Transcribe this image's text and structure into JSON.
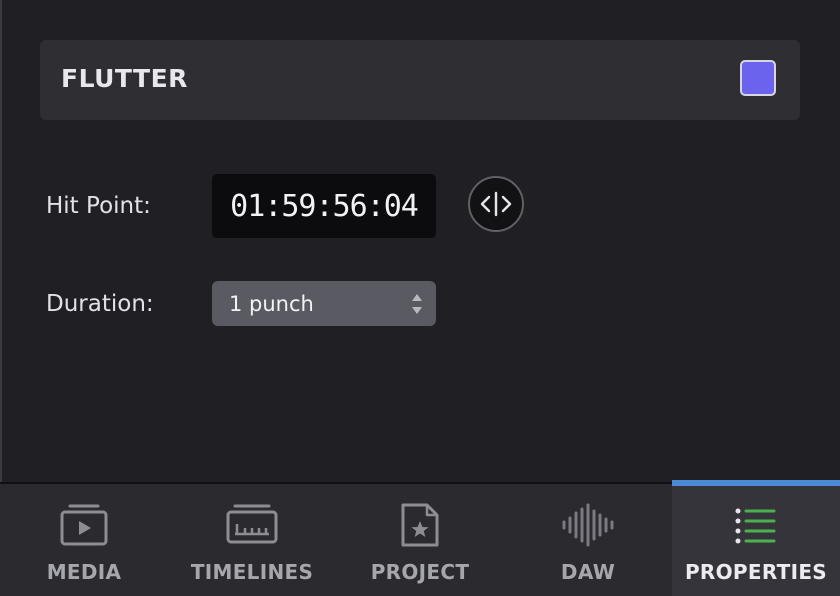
{
  "header": {
    "title": "FLUTTER",
    "swatch_color": "#6b63ee"
  },
  "hit_point": {
    "label": "Hit Point:",
    "timecode": "01:59:56:04"
  },
  "duration": {
    "label": "Duration:",
    "value": "1 punch"
  },
  "tabs": [
    {
      "label": "MEDIA",
      "icon": "media-icon",
      "active": false
    },
    {
      "label": "TIMELINES",
      "icon": "timelines-icon",
      "active": false
    },
    {
      "label": "PROJECT",
      "icon": "project-icon",
      "active": false
    },
    {
      "label": "DAW",
      "icon": "daw-icon",
      "active": false
    },
    {
      "label": "PROPERTIES",
      "icon": "properties-icon",
      "active": true
    }
  ],
  "colors": {
    "accent": "#4a8ad6",
    "properties_icon": "#4caf50"
  }
}
